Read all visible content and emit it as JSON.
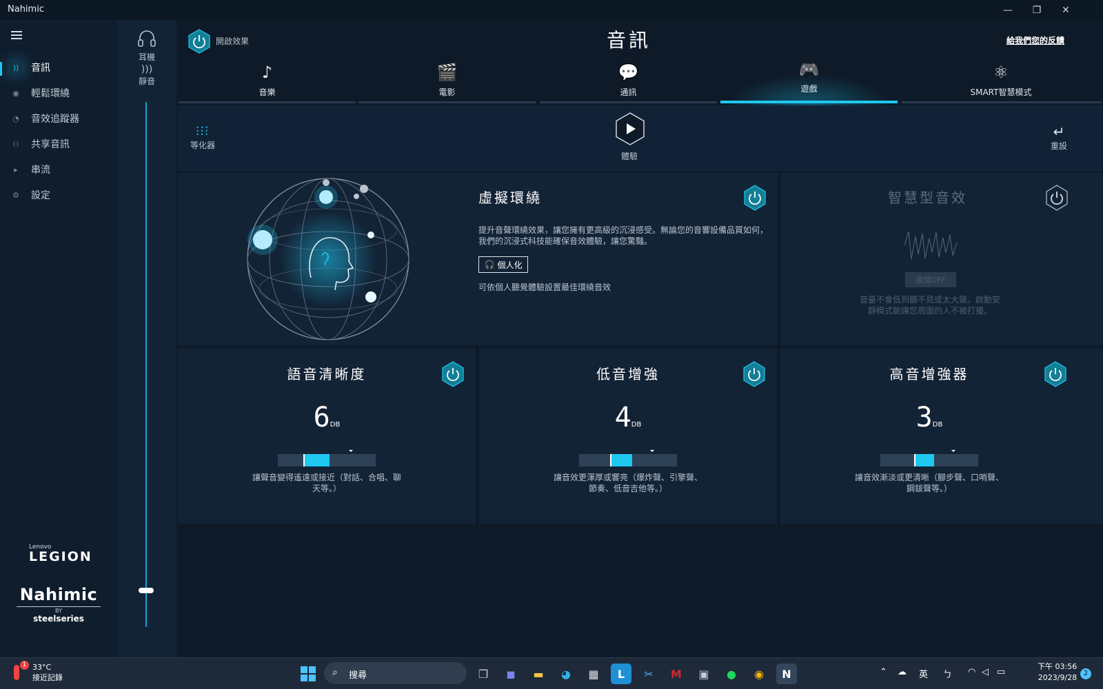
{
  "window": {
    "title": "Nahimic",
    "minimize": "—",
    "restore": "❐",
    "close": "✕"
  },
  "sidebar": {
    "items": [
      {
        "label": "音訊",
        "icon": "audio-waves-icon",
        "active": true
      },
      {
        "label": "輕鬆環繞",
        "icon": "surround-icon",
        "active": false
      },
      {
        "label": "音效追蹤器",
        "icon": "sound-tracker-icon",
        "active": false
      },
      {
        "label": "共享音訊",
        "icon": "share-audio-icon",
        "active": false
      },
      {
        "label": "串流",
        "icon": "stream-icon",
        "active": false
      },
      {
        "label": "設定",
        "icon": "gear-icon",
        "active": false
      }
    ],
    "brand_small": "Lenovo",
    "brand_big": "LEGION",
    "nahimic_name": "Nahimic",
    "nahimic_by": "BY",
    "nahimic_ss": "steelseries"
  },
  "devices": {
    "headphones_label": "耳機",
    "mute_label": "靜音",
    "volume": 0.07
  },
  "header": {
    "effect_label": "開啟效果",
    "title": "音訊",
    "feedback": "給我們您的反饋"
  },
  "tabs": [
    {
      "label": "音樂",
      "icon": "music-note-icon",
      "glyph": "♪",
      "active": false
    },
    {
      "label": "電影",
      "icon": "clapperboard-icon",
      "glyph": "🎬",
      "active": false
    },
    {
      "label": "通訊",
      "icon": "chat-bubbles-icon",
      "glyph": "💬",
      "active": false
    },
    {
      "label": "遊戲",
      "icon": "gamepad-icon",
      "glyph": "🎮",
      "active": true
    },
    {
      "label": "SMART智慧模式",
      "icon": "smart-atom-icon",
      "glyph": "⚛",
      "active": false
    }
  ],
  "toolbar": {
    "equalizer_label": "等化器",
    "play_label": "體驗",
    "reset_label": "重設"
  },
  "virtual_surround": {
    "title": "虛擬環繞",
    "description": "提升音聲環繞效果，讓您擁有更高級的沉浸感受。無論您的音響設備品質如何，我們的沉浸式科技能確保音效體驗，讓您驚豔。",
    "personalize_label": "個人化",
    "note": "可依個人聽覺體驗設置最佳環繞音效",
    "enabled": true
  },
  "smart_volume": {
    "title": "智慧型音效",
    "button_label": "夜間OFF",
    "description": "音量不會低到聽不見或太大聲。啟動安靜模式能讓您周圍的人不被打擾。",
    "enabled": false
  },
  "sliders": [
    {
      "title": "語音清晰度",
      "value": "6",
      "unit": "DB",
      "level": 0.6,
      "description": "讓聲音變得遙遠或接近（對話、合唱、聊天等。）"
    },
    {
      "title": "低音增強",
      "value": "4",
      "unit": "DB",
      "level": 0.4,
      "description": "讓音效更渾厚或響亮（爆炸聲、引擎聲、節奏、低音吉他等。）"
    },
    {
      "title": "高音增強器",
      "value": "3",
      "unit": "DB",
      "level": 0.3,
      "description": "讓音效漸淡或更清晰（腳步聲、口哨聲、鋼鈸聲等。）"
    }
  ],
  "taskbar": {
    "weather_temp": "33°C",
    "weather_label": "接近記錄",
    "weather_badge": "1",
    "search_label": "搜尋",
    "ime": "英",
    "clock_time": "下午 03:56",
    "clock_date": "2023/9/28",
    "notifications": "2"
  },
  "colors": {
    "accent": "#1ec8f0",
    "background": "#0e1a28",
    "card": "#132336",
    "sidebar": "#101d2d"
  }
}
